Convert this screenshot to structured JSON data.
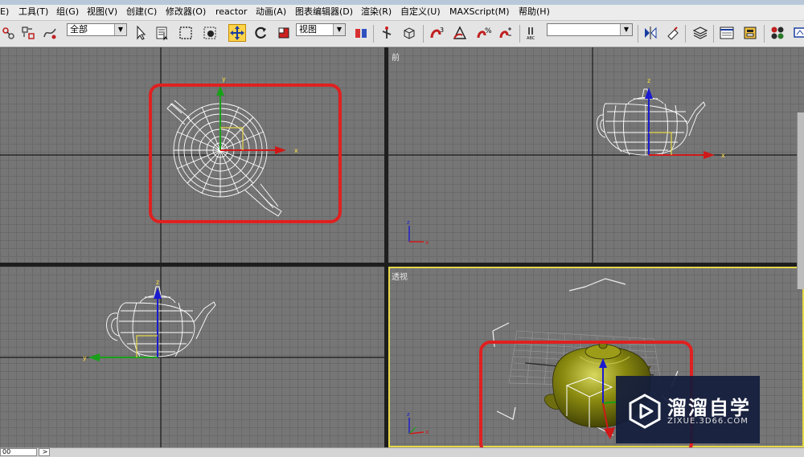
{
  "menubar": {
    "items": [
      {
        "id": "edit",
        "label": "E)"
      },
      {
        "id": "tools",
        "label": "工具(T)"
      },
      {
        "id": "group",
        "label": "组(G)"
      },
      {
        "id": "views",
        "label": "视图(V)"
      },
      {
        "id": "create",
        "label": "创建(C)"
      },
      {
        "id": "modifiers",
        "label": "修改器(O)"
      },
      {
        "id": "reactor",
        "label": "reactor"
      },
      {
        "id": "animation",
        "label": "动画(A)"
      },
      {
        "id": "graph",
        "label": "图表编辑器(D)"
      },
      {
        "id": "render",
        "label": "渲染(R)"
      },
      {
        "id": "customize",
        "label": "自定义(U)"
      },
      {
        "id": "maxscript",
        "label": "MAXScript(M)"
      },
      {
        "id": "help",
        "label": "帮助(H)"
      }
    ]
  },
  "toolbar": {
    "selection_filter": "全部",
    "reference_coord": "视图",
    "named_selection": "",
    "snap_label": "3",
    "angle_snap_label": "%",
    "abc_label": "ABC"
  },
  "viewports": {
    "top": {
      "label": "",
      "axis_x": "x",
      "axis_y": "y"
    },
    "front": {
      "label": "前",
      "axis_x": "x",
      "axis_y": "z"
    },
    "left": {
      "label": "",
      "axis_x": "y",
      "axis_y": "z"
    },
    "perspective": {
      "label": "透视",
      "axis_x": "x",
      "axis_y": "z"
    }
  },
  "statusbar": {
    "field": "00",
    "arrow": ">"
  },
  "watermark": {
    "title": "溜溜自学",
    "url": "ZIXUE.3D66.COM"
  },
  "colors": {
    "highlight": "#e02020",
    "active_border": "#e6d84a",
    "teapot_shaded": "#8a8a10",
    "axis_x": "#d01818",
    "axis_y": "#18a018",
    "axis_z": "#1a1ad0"
  }
}
